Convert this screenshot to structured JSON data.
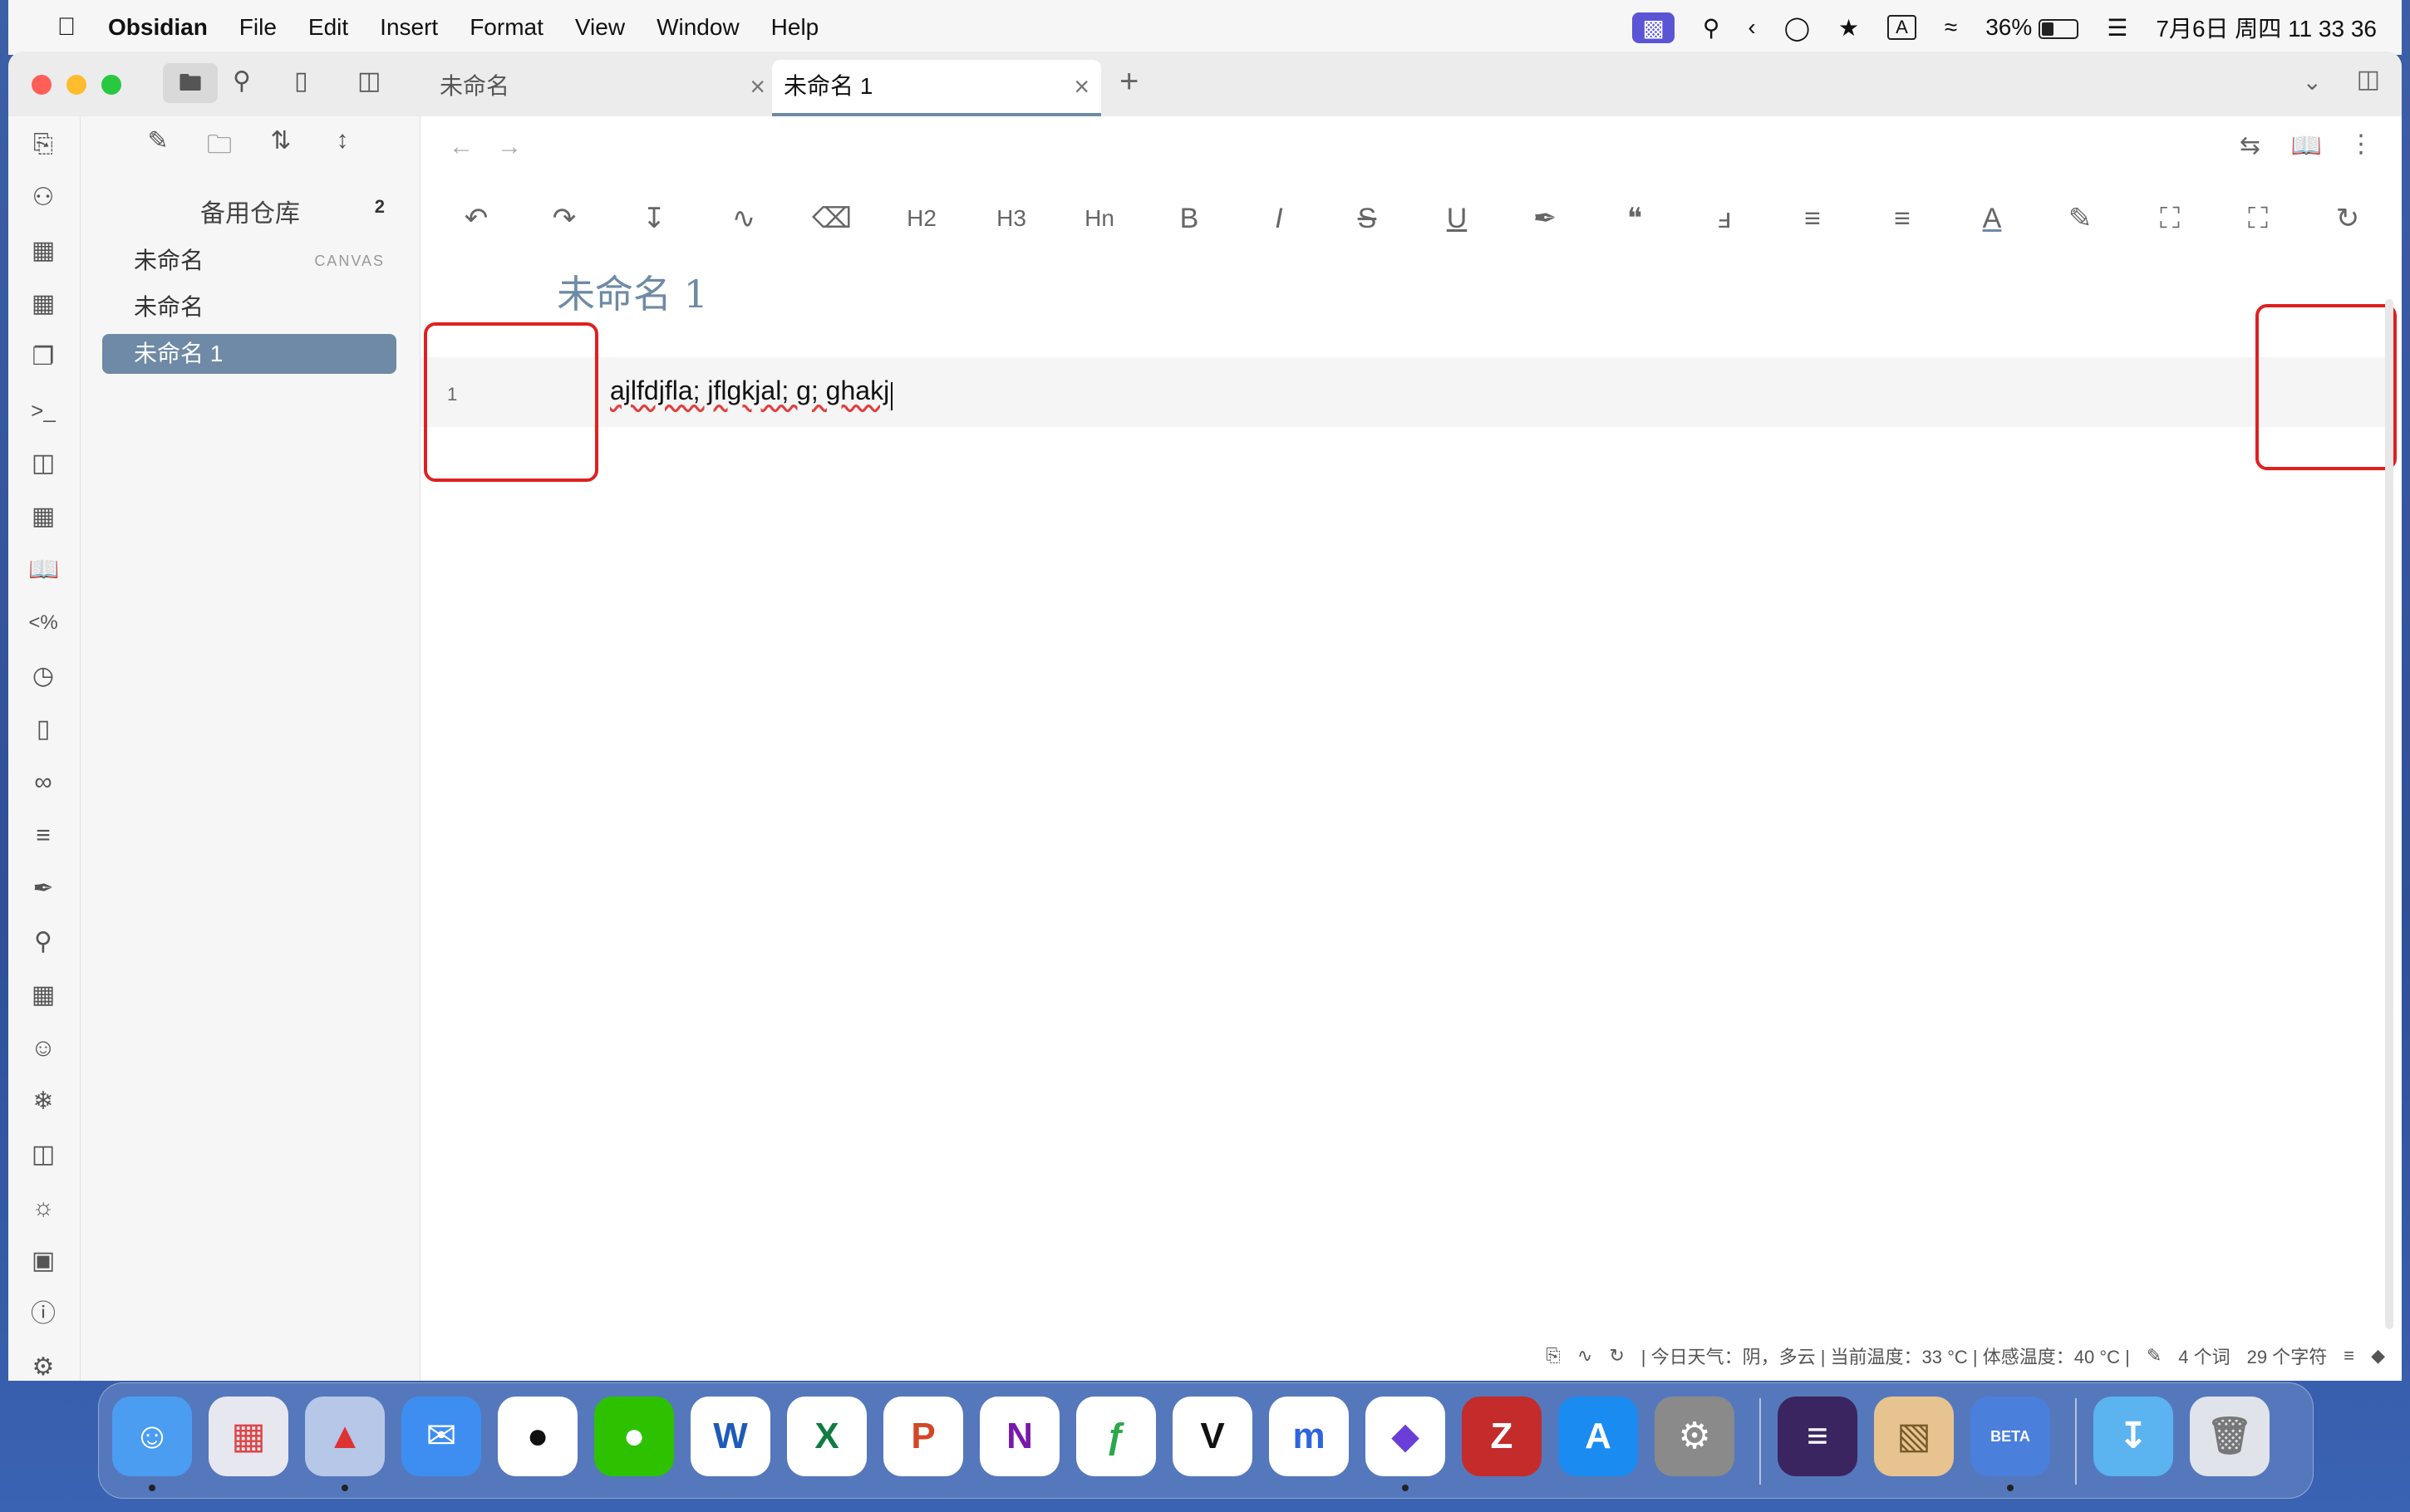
{
  "menubar": {
    "apple": "",
    "app": "Obsidian",
    "menus": [
      "File",
      "Edit",
      "Insert",
      "Format",
      "View",
      "Window",
      "Help"
    ],
    "battery": "36%",
    "battery_level": 0.36,
    "input_method": "A",
    "datetime": "7月6日 周四  11 33 36"
  },
  "tabs": [
    {
      "label": "未命名",
      "active": false
    },
    {
      "label": "未命名 1",
      "active": true
    }
  ],
  "sidebar": {
    "vault_name": "备用仓库",
    "vault_count": "2",
    "files": [
      {
        "name": "未命名",
        "badge": "CANVAS",
        "active": false
      },
      {
        "name": "未命名",
        "badge": "",
        "active": false
      },
      {
        "name": "未命名 1",
        "badge": "",
        "active": true
      }
    ]
  },
  "toolbar": {
    "h2": "H2",
    "h3": "H3",
    "hn": "Hn",
    "bold": "B",
    "italic": "I",
    "strike": "S",
    "underline": "U",
    "font_color": "A"
  },
  "editor": {
    "title": "未命名 1",
    "line_number": "1",
    "line_text": "ajlfdjfla; jflgkjal; g; ghakj"
  },
  "status": {
    "weather": "| 今日天气：阴，多云 | 当前温度：33 °C | 体感温度：40 °C |",
    "words": "4 个词",
    "chars": "29 个字符"
  },
  "dock": {
    "word_letter": "W",
    "excel_letter": "X",
    "ppt_letter": "P",
    "onenote_letter": "N",
    "zotero_letter": "Z",
    "beta_label": "BETA"
  }
}
